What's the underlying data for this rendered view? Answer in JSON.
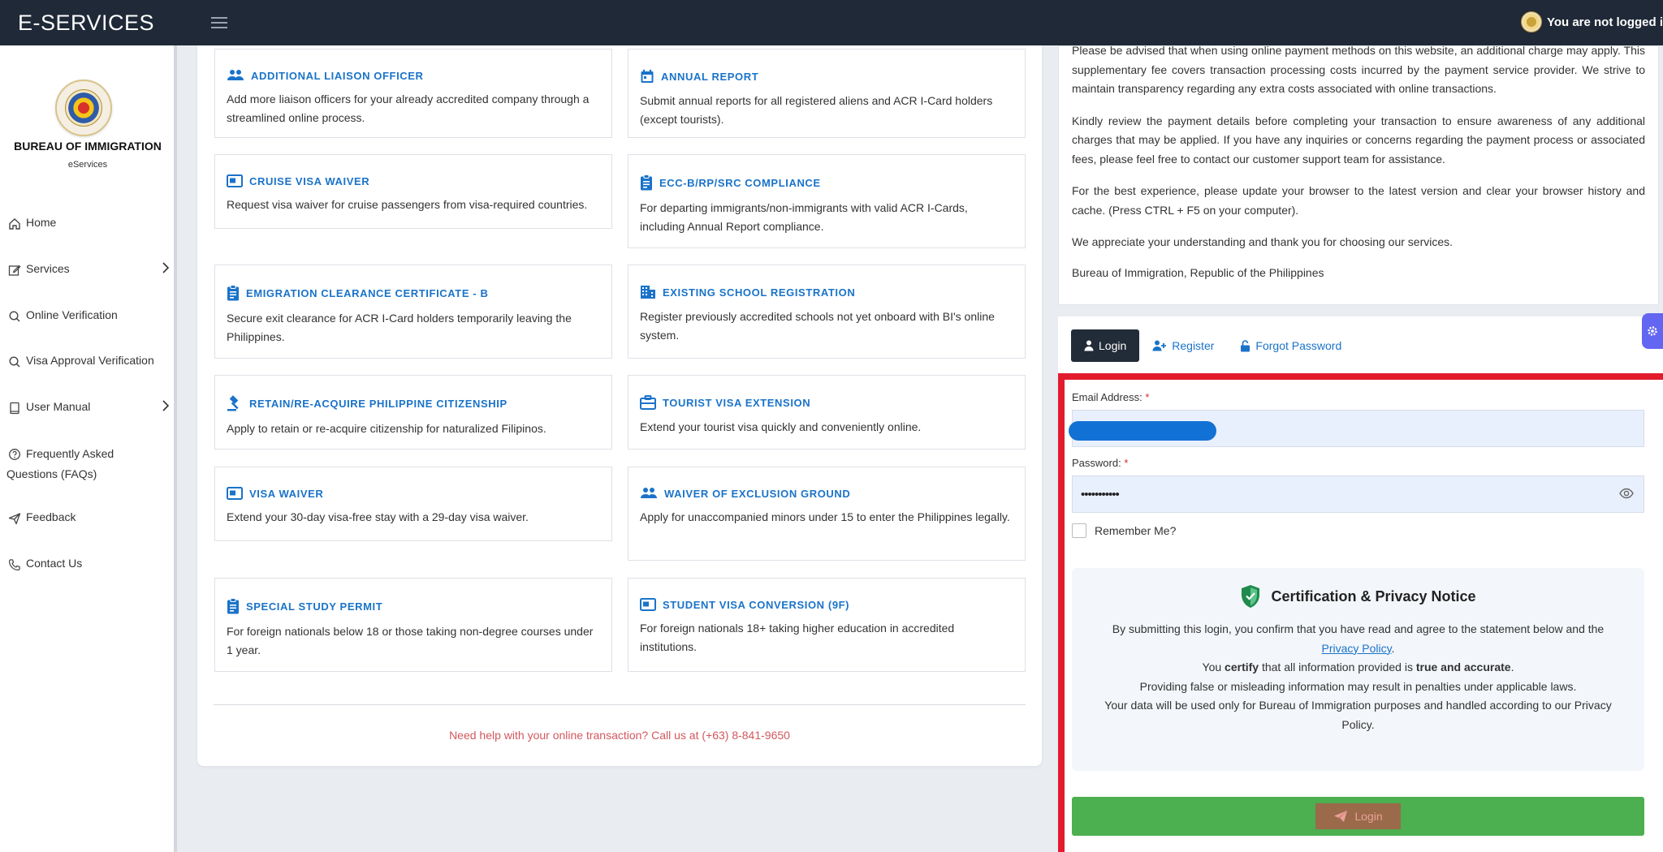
{
  "header": {
    "brand": "E-SERVICES",
    "user_status": "You are not logged i"
  },
  "sidebar": {
    "agency_name": "BUREAU OF IMMIGRATION",
    "agency_sub": "eServices",
    "items": [
      {
        "label": "Home",
        "icon": "home-icon"
      },
      {
        "label": "Services",
        "icon": "edit-icon",
        "has_submenu": true
      },
      {
        "label": "Online Verification",
        "icon": "search-icon"
      },
      {
        "label": "Visa Approval Verification",
        "icon": "search-icon"
      },
      {
        "label": "User Manual",
        "icon": "book-icon",
        "has_submenu": true
      },
      {
        "label_line1": "Frequently Asked",
        "label_line2": "Questions (FAQs)",
        "icon": "question-icon"
      },
      {
        "label": "Feedback",
        "icon": "send-icon"
      },
      {
        "label": "Contact Us",
        "icon": "phone-icon"
      }
    ]
  },
  "services": [
    {
      "title": "ADDITIONAL LIAISON OFFICER",
      "icon": "people-icon",
      "desc": "Add more liaison officers for your already accredited company through a streamlined online process."
    },
    {
      "title": "ANNUAL REPORT",
      "icon": "calendar-icon",
      "desc": "Submit annual reports for all registered aliens and ACR I-Card holders (except tourists)."
    },
    {
      "title": "CRUISE VISA WAIVER",
      "icon": "id-card-icon",
      "desc": "Request visa waiver for cruise passengers from visa-required countries."
    },
    {
      "title": "ECC-B/RP/SRC COMPLIANCE",
      "icon": "clipboard-icon",
      "desc": "For departing immigrants/non-immigrants with valid ACR I-Cards, including Annual Report compliance."
    },
    {
      "title": "EMIGRATION CLEARANCE CERTIFICATE - B",
      "icon": "clipboard-icon",
      "desc": "Secure exit clearance for ACR I-Card holders temporarily leaving the Philippines."
    },
    {
      "title": "EXISTING SCHOOL REGISTRATION",
      "icon": "building-icon",
      "desc": "Register previously accredited schools not yet onboard with BI's online system."
    },
    {
      "title": "RETAIN/RE-ACQUIRE PHILIPPINE CITIZENSHIP",
      "icon": "gavel-icon",
      "desc": "Apply to retain or re-acquire citizenship for naturalized Filipinos."
    },
    {
      "title": "TOURIST VISA EXTENSION",
      "icon": "briefcase-icon",
      "desc": "Extend your tourist visa quickly and conveniently online."
    },
    {
      "title": "VISA WAIVER",
      "icon": "id-card-icon",
      "desc": "Extend your 30-day visa-free stay with a 29-day visa waiver."
    },
    {
      "title": "WAIVER OF EXCLUSION GROUND",
      "icon": "people-icon",
      "desc": "Apply for unaccompanied minors under 15 to enter the Philippines legally."
    },
    {
      "title": "SPECIAL STUDY PERMIT",
      "icon": "clipboard-icon",
      "desc": "For foreign nationals below 18 or those taking non-degree courses under 1 year."
    },
    {
      "title": "STUDENT VISA CONVERSION (9F)",
      "icon": "id-card-icon",
      "desc": "For foreign nationals 18+ taking higher education in accredited institutions."
    }
  ],
  "helpline": "Need help with your online transaction? Call us at (+63) 8-841-9650",
  "notice": {
    "p1": "Please be advised that when using online payment methods on this website, an additional charge may apply. This supplementary fee covers transaction processing costs incurred by the payment service provider. We strive to maintain transparency regarding any extra costs associated with online transactions.",
    "p2": "Kindly review the payment details before completing your transaction to ensure awareness of any additional charges that may be applied. If you have any inquiries or concerns regarding the payment process or associated fees, please feel free to contact our customer support team for assistance.",
    "p3": "For the best experience, please update your browser to the latest version and clear your browser history and cache. (Press CTRL + F5 on your computer).",
    "p4": "We appreciate your understanding and thank you for choosing our services.",
    "p5": "Bureau of Immigration, Republic of the Philippines"
  },
  "login": {
    "tabs": {
      "login": "Login",
      "register": "Register",
      "forgot": "Forgot Password"
    },
    "email_label": "Email Address:",
    "password_label": "Password:",
    "required_mark": "*",
    "password_value": "•••••••••••",
    "remember_label": "Remember Me?",
    "submit_label": "Login"
  },
  "certification": {
    "title": "Certification & Privacy Notice",
    "line1": "By submitting this login, you confirm that you have read and agree to the statement below and the",
    "privacy_link": "Privacy Policy",
    "line2_pre": "You ",
    "line2_bold1": "certify",
    "line2_mid": " that all information provided is ",
    "line2_bold2": "true and accurate",
    "line3": "Providing false or misleading information may result in penalties under applicable laws.",
    "line4": "Your data will be used only for Bureau of Immigration purposes and handled according to our Privacy Policy."
  },
  "colors": {
    "topbar": "#1f2937",
    "accent": "#1a73c9",
    "highlight_frame": "#e21b2d",
    "login_button": "#4caf50",
    "helpline": "#d2585e"
  }
}
